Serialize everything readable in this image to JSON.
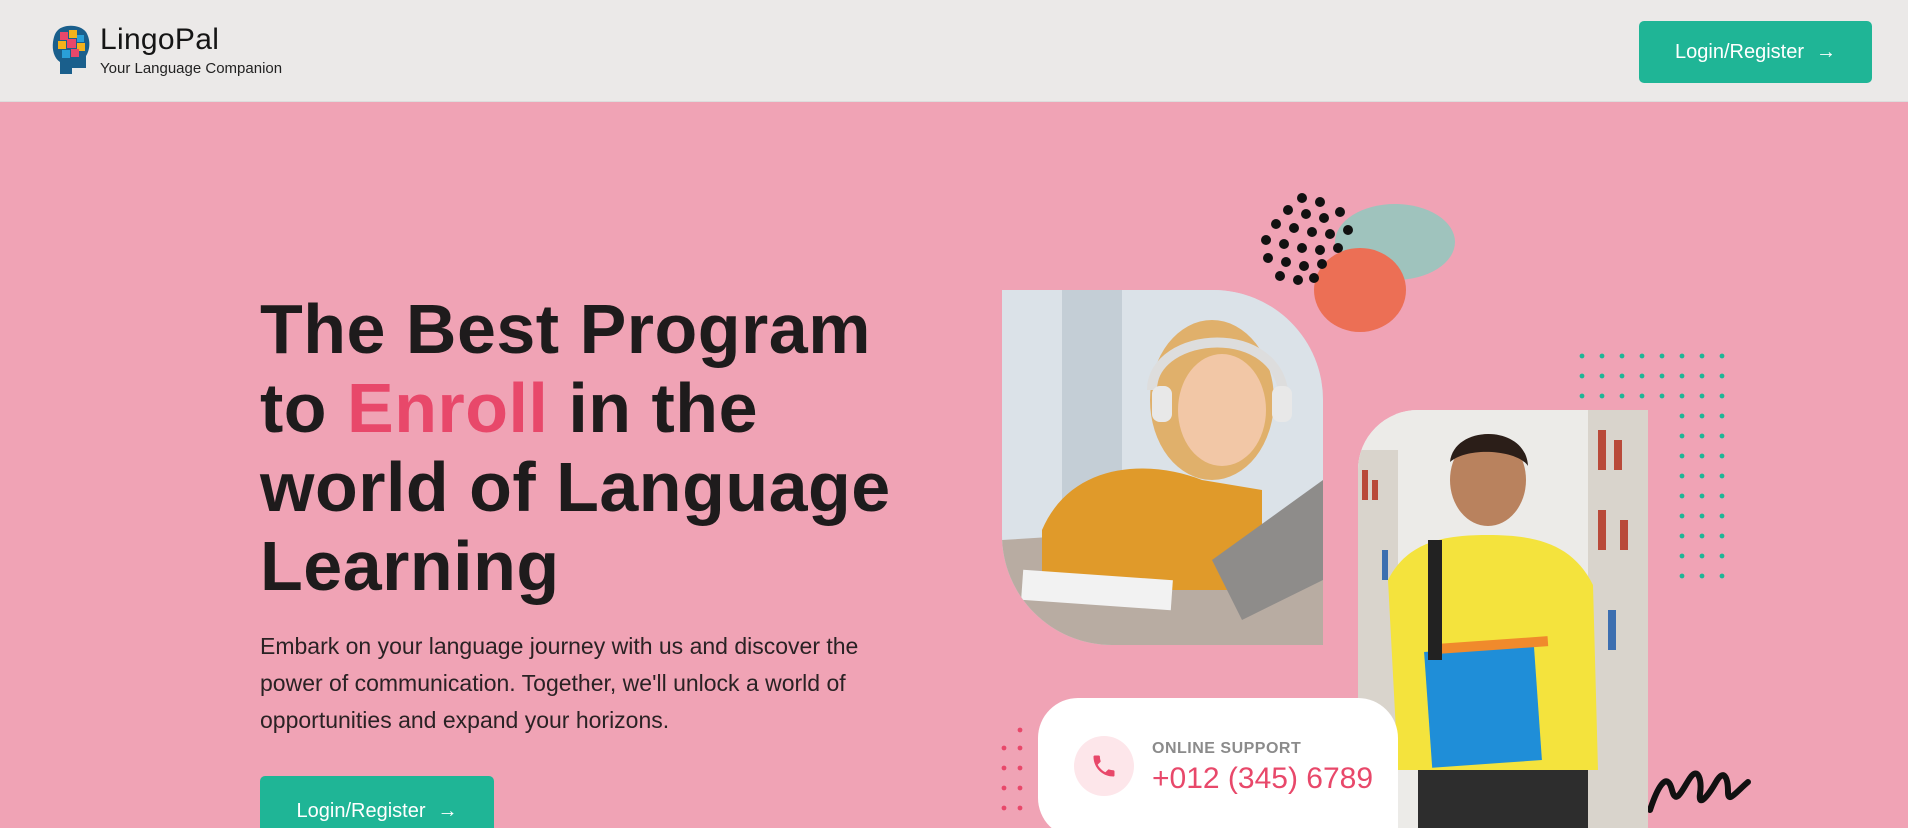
{
  "header": {
    "brand_name": "LingoPal",
    "brand_tagline": "Your Language Companion",
    "cta_label": "Login/Register"
  },
  "hero": {
    "title_part1": "The Best Program to ",
    "title_accent": "Enroll",
    "title_part2": " in the world of Language Learning",
    "description": "Embark on your language journey with us and discover the power of communication. Together, we'll unlock a world of opportunities and expand your horizons.",
    "cta_label": "Login/Register"
  },
  "support": {
    "label": "ONLINE SUPPORT",
    "phone": "+012 (345) 6789"
  },
  "icons": {
    "logo": "puzzle-head-icon",
    "arrow": "arrow-right-icon",
    "phone": "phone-icon"
  },
  "colors": {
    "hero_bg": "#f0a3b5",
    "header_bg": "#ebe9e8",
    "primary": "#1fb596",
    "accent": "#e8486a",
    "heading": "#1e1b1c"
  }
}
